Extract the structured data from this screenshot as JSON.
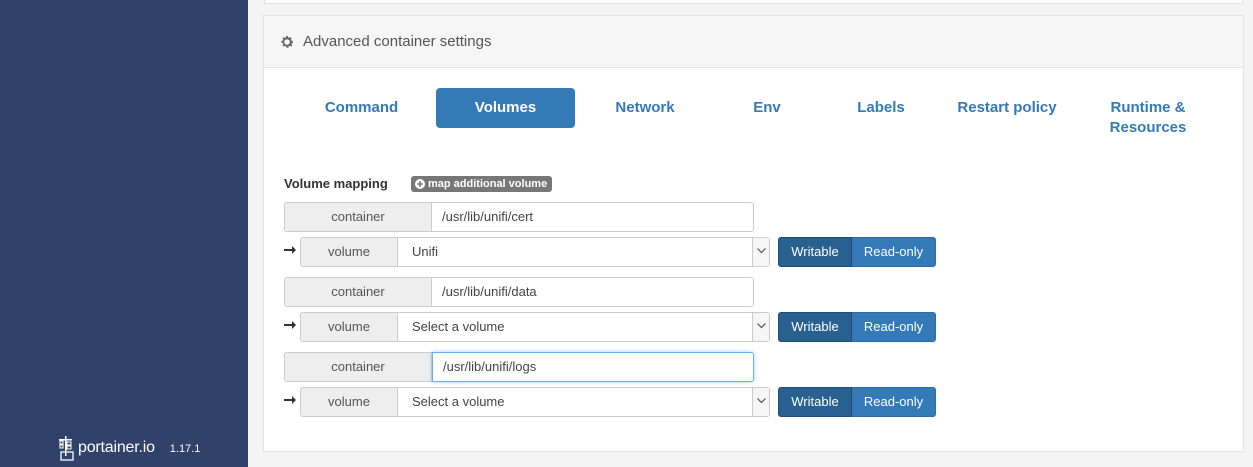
{
  "brand": {
    "name": "portainer.io",
    "version": "1.17.1"
  },
  "panel": {
    "title": "Advanced container settings",
    "icon": "gear-icon"
  },
  "tabs": [
    {
      "label": "Command",
      "active": false
    },
    {
      "label": "Volumes",
      "active": true
    },
    {
      "label": "Network",
      "active": false
    },
    {
      "label": "Env",
      "active": false
    },
    {
      "label": "Labels",
      "active": false
    },
    {
      "label": "Restart policy",
      "active": false
    },
    {
      "label": "Runtime &",
      "label2": "Resources",
      "active": false
    }
  ],
  "volumes": {
    "section_label": "Volume mapping",
    "add_button": "map additional volume",
    "container_label": "container",
    "volume_label": "volume",
    "writable_label": "Writable",
    "readonly_label": "Read-only",
    "mappings": [
      {
        "container_path": "/usr/lib/unifi/cert",
        "volume": "Unifi",
        "mode": "Writable"
      },
      {
        "container_path": "/usr/lib/unifi/data",
        "volume": "Select a volume",
        "mode": "Writable"
      },
      {
        "container_path": "/usr/lib/unifi/logs",
        "volume": "Select a volume",
        "mode": "Writable"
      }
    ]
  },
  "colors": {
    "sidebar": "#30426a",
    "primary": "#337ab7",
    "active_button": "#286090"
  }
}
